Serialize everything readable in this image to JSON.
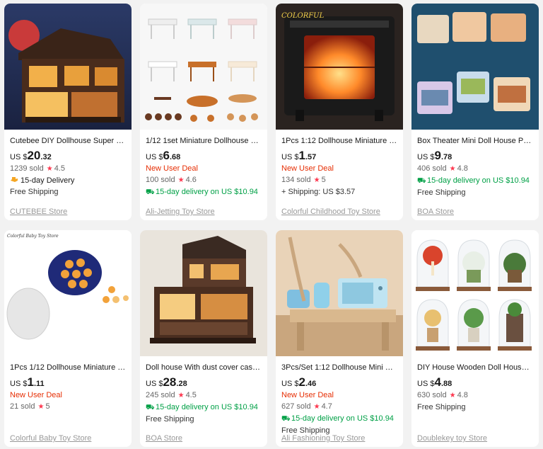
{
  "products": [
    {
      "title": "Cutebee DIY Dollhouse Super Mini...",
      "currency": "US $",
      "price_int": "20",
      "price_dec": ".32",
      "deal": "",
      "sold": "1239 sold",
      "rating": "4.5",
      "delivery": "15-day Delivery",
      "delivery_style": "orange",
      "extra": "Free Shipping",
      "store": "CUTEBEE Store",
      "thumb_icon": "dollhouse-lit-icon"
    },
    {
      "title": "1/12 1set Miniature Dollhouse Fur...",
      "currency": "US $",
      "price_int": "6",
      "price_dec": ".68",
      "deal": "New User Deal",
      "sold": "100 sold",
      "rating": "4.6",
      "delivery": "15-day delivery on US $10.94",
      "delivery_style": "green",
      "extra": "",
      "store": "Ali-Jetting Toy Store",
      "thumb_icon": "mini-furniture-icon"
    },
    {
      "title": "1Pcs 1:12 Dollhouse Miniature Sim...",
      "currency": "US $",
      "price_int": "1",
      "price_dec": ".57",
      "deal": "New User Deal",
      "sold": "134 sold",
      "rating": "5",
      "delivery": "",
      "delivery_style": "",
      "extra": "+ Shipping: US $3.57",
      "store": "Colorful Childhood Toy Store",
      "thumb_icon": "fireplace-icon",
      "thumb_brand": "COLORFUL"
    },
    {
      "title": "Box Theater Mini Doll House Prefa...",
      "currency": "US $",
      "price_int": "9",
      "price_dec": ".78",
      "deal": "",
      "sold": "406 sold",
      "rating": "4.8",
      "delivery": "15-day delivery on US $10.94",
      "delivery_style": "green",
      "extra": "Free Shipping",
      "store": "BOA Store",
      "thumb_icon": "box-theater-icon"
    },
    {
      "title": "1Pcs 1/12 Dollhouse Miniature Da...",
      "currency": "US $",
      "price_int": "1",
      "price_dec": ".11",
      "deal": "New User Deal",
      "sold": "21 sold",
      "rating": "5",
      "delivery": "",
      "delivery_style": "",
      "extra": "",
      "store": "Colorful Baby Toy Store",
      "thumb_icon": "cookie-tin-icon",
      "thumb_brand": "Colorful Baby Toy Store"
    },
    {
      "title": "Doll house With dust cover casa M...",
      "currency": "US $",
      "price_int": "28",
      "price_dec": ".28",
      "deal": "",
      "sold": "245 sold",
      "rating": "4.5",
      "delivery": "15-day delivery on US $10.94",
      "delivery_style": "green",
      "extra": "Free Shipping",
      "store": "BOA Store",
      "thumb_icon": "wooden-dollhouse-icon"
    },
    {
      "title": "3Pcs/Set 1:12 Dollhouse Mini Micr...",
      "currency": "US $",
      "price_int": "2",
      "price_dec": ".46",
      "deal": "New User Deal",
      "sold": "627 sold",
      "rating": "4.7",
      "delivery": "15-day delivery on US $10.94",
      "delivery_style": "green",
      "extra": "Free Shipping",
      "store": "Ali Fashioning Toy Store",
      "thumb_icon": "mini-appliances-icon"
    },
    {
      "title": "DIY House Wooden Doll Houses M...",
      "currency": "US $",
      "price_int": "4",
      "price_dec": ".88",
      "deal": "",
      "sold": "630 sold",
      "rating": "4.8",
      "delivery": "",
      "delivery_style": "",
      "extra": "Free Shipping",
      "store": "Doublekey toy Store",
      "thumb_icon": "glass-dome-houses-icon"
    }
  ],
  "colors": {
    "deal": "#e62e04",
    "green_delivery": "#00a046",
    "star": "#fd384f",
    "store_link": "#999999"
  }
}
